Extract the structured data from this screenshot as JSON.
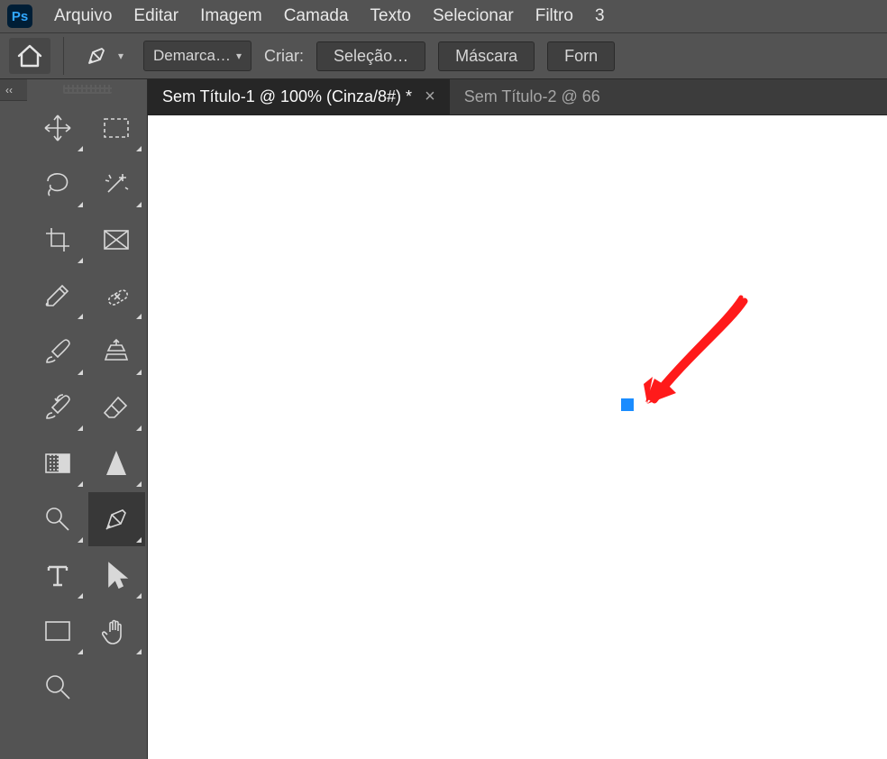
{
  "app": {
    "logo_text": "Ps"
  },
  "menu": {
    "items": [
      "Arquivo",
      "Editar",
      "Imagem",
      "Camada",
      "Texto",
      "Selecionar",
      "Filtro",
      "3"
    ]
  },
  "options": {
    "mode_label": "Demarca…",
    "create_label": "Criar:",
    "selection_btn": "Seleção…",
    "mask_btn": "Máscara",
    "shape_btn": "Forn"
  },
  "panel": {
    "collapse_label": "‹‹"
  },
  "tabs": {
    "active": "Sem Título-1 @ 100% (Cinza/8#) *",
    "inactive": "Sem Título-2 @ 66"
  },
  "tools": {
    "names": [
      "move-tool",
      "marquee-tool",
      "lasso-tool",
      "magic-wand-tool",
      "crop-tool",
      "frame-tool",
      "eyedropper-tool",
      "spot-heal-tool",
      "brush-tool",
      "clone-stamp-tool",
      "history-brush-tool",
      "eraser-tool",
      "gradient-tool",
      "blur-tool",
      "dodge-tool",
      "pen-tool",
      "type-tool",
      "path-selection-tool",
      "rectangle-tool",
      "hand-tool",
      "zoom-tool"
    ]
  },
  "canvas": {
    "anchor_color": "#1a8cff"
  }
}
